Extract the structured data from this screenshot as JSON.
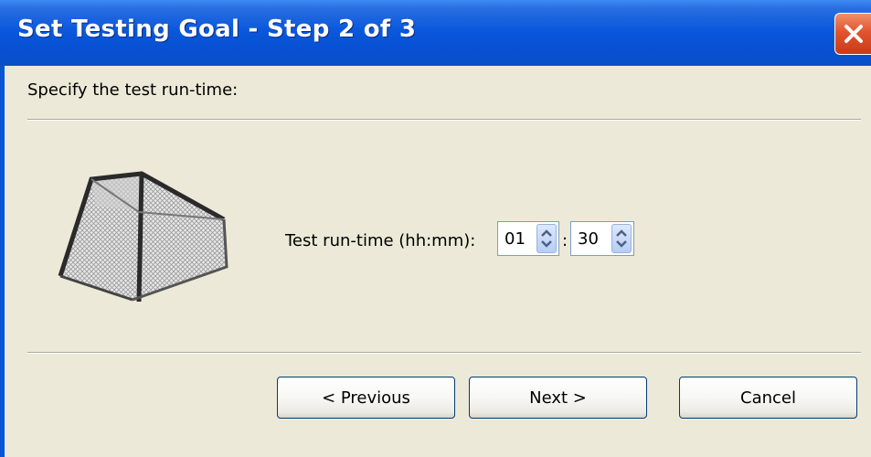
{
  "window": {
    "title": "Set Testing Goal - Step 2 of 3",
    "close_icon": "close-icon"
  },
  "content": {
    "instruction": "Specify the test run-time:",
    "image_icon": "soccer-goal-icon",
    "runtime_label": "Test run-time (hh:mm):",
    "hours": "01",
    "separator": ":",
    "minutes": "30"
  },
  "buttons": {
    "previous": "< Previous",
    "next": "Next >",
    "cancel": "Cancel"
  },
  "colors": {
    "titlebar": "#0a58dd",
    "background": "#ece9d8",
    "close": "#e2542f"
  }
}
